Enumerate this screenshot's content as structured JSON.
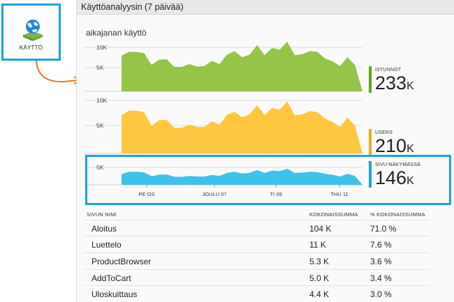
{
  "tile": {
    "label": "KÄYTTÖ"
  },
  "blade": {
    "title": "Käyttöanalyysin (7 päivää)"
  },
  "chart_title": "aikajanan käyttö",
  "colors": {
    "sessions": "#8fc13e",
    "users": "#ffc435",
    "pageviews": "#35bfe8",
    "highlight": "#1aa3e0",
    "arrow": "#f07322"
  },
  "summaries": [
    {
      "label": "ISTUNNOT",
      "value": "233",
      "unit": "K",
      "color": "#63a51e"
    },
    {
      "label": "USERS",
      "value": "210",
      "unit": "K",
      "color": "#f7a81b"
    },
    {
      "label": "SIVU-NÄKYMÄSSÄ",
      "value": "146",
      "unit": "K",
      "color": "#1aa3e0"
    }
  ],
  "chart_data": [
    {
      "type": "area",
      "name": "ISTUNNOT",
      "ylim": [
        0,
        12000
      ],
      "yticks": [
        "5K",
        "10K"
      ],
      "values": [
        8800,
        9700,
        9700,
        9400,
        6500,
        7800,
        7900,
        6000,
        6000,
        6700,
        6100,
        6200,
        7500,
        6700,
        9000,
        9900,
        8400,
        9000,
        11400,
        8900,
        10700,
        10200,
        12200,
        8900,
        9100,
        9900,
        9700,
        8100,
        7400,
        6200,
        8400,
        6500,
        0
      ]
    },
    {
      "type": "area",
      "name": "USERS",
      "ylim": [
        0,
        12000
      ],
      "yticks": [
        "5K",
        "10K"
      ],
      "values": [
        8200,
        9200,
        9200,
        8900,
        5900,
        7200,
        7200,
        5500,
        5500,
        6200,
        5700,
        5700,
        6900,
        6200,
        8300,
        9000,
        7800,
        8400,
        10400,
        8200,
        9800,
        9400,
        11200,
        8200,
        8400,
        9100,
        8900,
        7500,
        6800,
        5700,
        7700,
        6000,
        0
      ]
    },
    {
      "type": "area",
      "name": "SIVU-NÄKYMÄSSÄ",
      "ylim": [
        0,
        7500
      ],
      "yticks": [
        "5K"
      ],
      "x_ticks": [
        "PE OS",
        "JOULU 07",
        "TI 09",
        "THU 11"
      ],
      "values": [
        3600,
        4400,
        4400,
        4200,
        2900,
        3400,
        3500,
        2700,
        2700,
        3000,
        2800,
        2800,
        3300,
        3000,
        4000,
        4400,
        3800,
        4000,
        5000,
        4000,
        4800,
        4600,
        5400,
        4000,
        4100,
        4400,
        4300,
        3700,
        3400,
        2800,
        3700,
        3000,
        0
      ]
    }
  ],
  "table": {
    "headers": [
      "SIVUN NIMI",
      "KOKONAISSUMMA",
      "% KOKONAISSUMMA"
    ],
    "rows": [
      [
        "Aloitus",
        "104 K",
        "71.0 %"
      ],
      [
        "Luettelo",
        "11 K",
        "7.6 %"
      ],
      [
        "ProductBrowser",
        "5.3 K",
        "3.6 %"
      ],
      [
        "AddToCart",
        "5.0 K",
        "3.4 %"
      ],
      [
        "Uloskuittaus",
        "4.4 K",
        "3.0 %"
      ]
    ]
  }
}
